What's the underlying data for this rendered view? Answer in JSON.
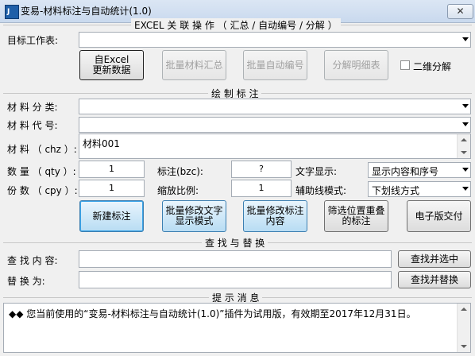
{
  "window": {
    "title": "变易-材料标注与自动统计(1.0)",
    "close_glyph": "✕",
    "icon_text": "J",
    "accent": "#1f5fa8"
  },
  "excel_section": {
    "header": "EXCEL 关 联 操 作 （ 汇总 / 自动编号 / 分解 ）",
    "target_sheet_label": "目标工作表:",
    "target_sheet_value": "",
    "update_button": "自Excel\n更新数据",
    "batch_summary_button": "批量材料汇总",
    "batch_number_button": "批量自动编号",
    "detail_button": "分解明细表",
    "two_dim_label": "二维分解",
    "two_dim_checked": false
  },
  "draw_section": {
    "header": "绘 制 标 注",
    "category_label": "材 料 分 类:",
    "category_value": "",
    "code_label": "材 料 代 号:",
    "code_value": "",
    "chz_label": "材 料 （ chz ）:",
    "chz_value": "材料001",
    "qty_label": "数 量 （ qty ）:",
    "qty_value": "1",
    "bzc_label": "标注(bzc):",
    "bzc_value": "?",
    "text_display_label": "文字显示:",
    "text_display_value": "显示内容和序号",
    "cpy_label": "份 数 （ cpy ）:",
    "cpy_value": "1",
    "scale_label": "缩放比例:",
    "scale_value": "1",
    "aux_line_label": "辅助线模式:",
    "aux_line_value": "下划线方式",
    "new_button": "新建标注",
    "batch_text_button": "批量修改文字\n显示模式",
    "batch_content_button": "批量修改标注\n内容",
    "filter_button": "筛选位置重叠\n的标注",
    "e_delivery_button": "电子版交付"
  },
  "find_section": {
    "header": "查 找 与 替 换",
    "find_label": "查 找 内 容:",
    "find_value": "",
    "replace_label": "替 换 为:",
    "replace_value": "",
    "find_button": "查找并选中",
    "replace_button": "查找并替换"
  },
  "info_section": {
    "header": "提 示 消 息",
    "message": "◆◆ 您当前使用的“变易-材料标注与自动统计(1.0)”插件为试用版，有效期至2017年12月31日。"
  }
}
